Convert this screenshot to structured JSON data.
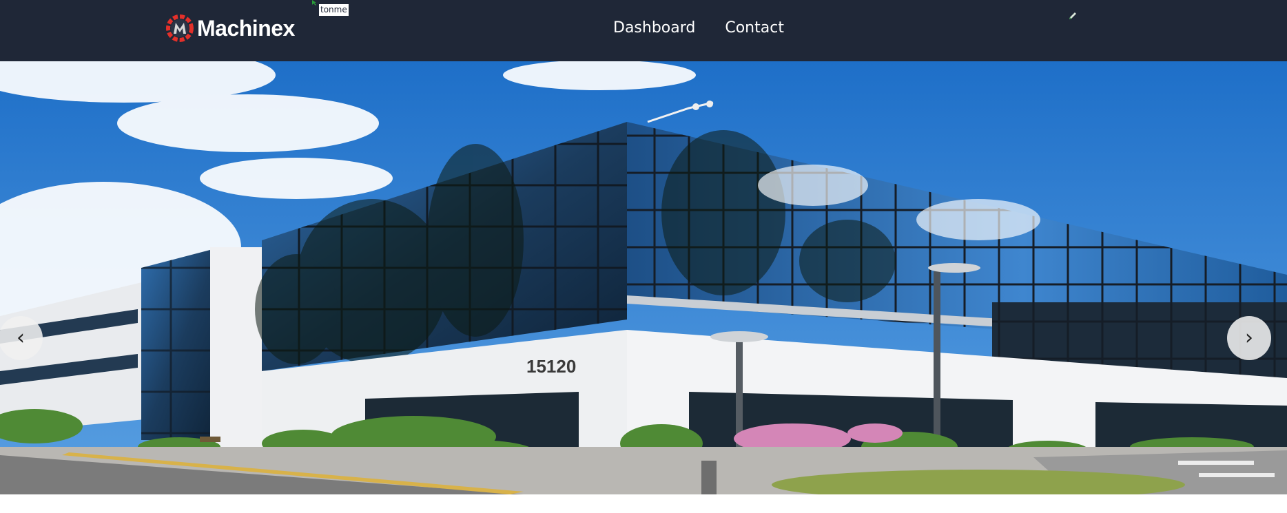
{
  "brand": {
    "name": "Machinex",
    "logo_icon": "gear-m-logo-icon",
    "colors": {
      "navbar": "#1f2737",
      "accent": "#e3302a"
    }
  },
  "overlay": {
    "stray_label": "tonme"
  },
  "nav": {
    "links": [
      {
        "label": "Dashboard"
      },
      {
        "label": "Contact"
      }
    ]
  },
  "hero": {
    "building_number": "15120",
    "prev_label": "‹",
    "next_label": "›"
  }
}
